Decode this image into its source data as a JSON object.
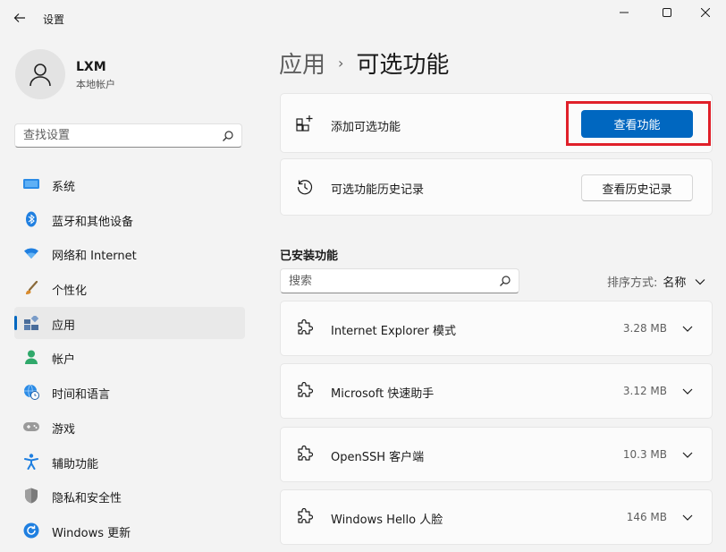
{
  "window": {
    "title": "设置"
  },
  "user": {
    "name": "LXM",
    "account_type": "本地帐户"
  },
  "sidebar": {
    "search_placeholder": "查找设置",
    "items": [
      {
        "label": "系统",
        "icon": "display-icon",
        "color": "#2b8be6"
      },
      {
        "label": "蓝牙和其他设备",
        "icon": "bluetooth-icon",
        "color": "#1f7fe0"
      },
      {
        "label": "网络和 Internet",
        "icon": "wifi-icon",
        "color": "#1f7fe0"
      },
      {
        "label": "个性化",
        "icon": "brush-icon",
        "color": "#d88a2c"
      },
      {
        "label": "应用",
        "icon": "apps-icon",
        "color": "#4a6d9a",
        "active": true
      },
      {
        "label": "帐户",
        "icon": "person-icon",
        "color": "#2fa86a"
      },
      {
        "label": "时间和语言",
        "icon": "globe-clock-icon",
        "color": "#2b8be6"
      },
      {
        "label": "游戏",
        "icon": "gamepad-icon",
        "color": "#8a8a8a"
      },
      {
        "label": "辅助功能",
        "icon": "accessibility-icon",
        "color": "#1f7fe0"
      },
      {
        "label": "隐私和安全性",
        "icon": "shield-icon",
        "color": "#6b6b6b"
      },
      {
        "label": "Windows 更新",
        "icon": "update-icon",
        "color": "#1f7fe0"
      }
    ]
  },
  "breadcrumb": {
    "parent": "应用",
    "separator": "›",
    "current": "可选功能"
  },
  "add_feature": {
    "label": "添加可选功能",
    "button": "查看功能"
  },
  "history": {
    "label": "可选功能历史记录",
    "button": "查看历史记录"
  },
  "installed": {
    "title": "已安装功能",
    "search_placeholder": "搜索",
    "sort_label": "排序方式:",
    "sort_value": "名称",
    "features": [
      {
        "name": "Internet Explorer 模式",
        "size": "3.28 MB"
      },
      {
        "name": "Microsoft 快速助手",
        "size": "3.12 MB"
      },
      {
        "name": "OpenSSH 客户端",
        "size": "10.3 MB"
      },
      {
        "name": "Windows Hello 人脸",
        "size": "146 MB"
      }
    ]
  },
  "colors": {
    "accent": "#0067c0",
    "highlight": "#e0202a"
  }
}
